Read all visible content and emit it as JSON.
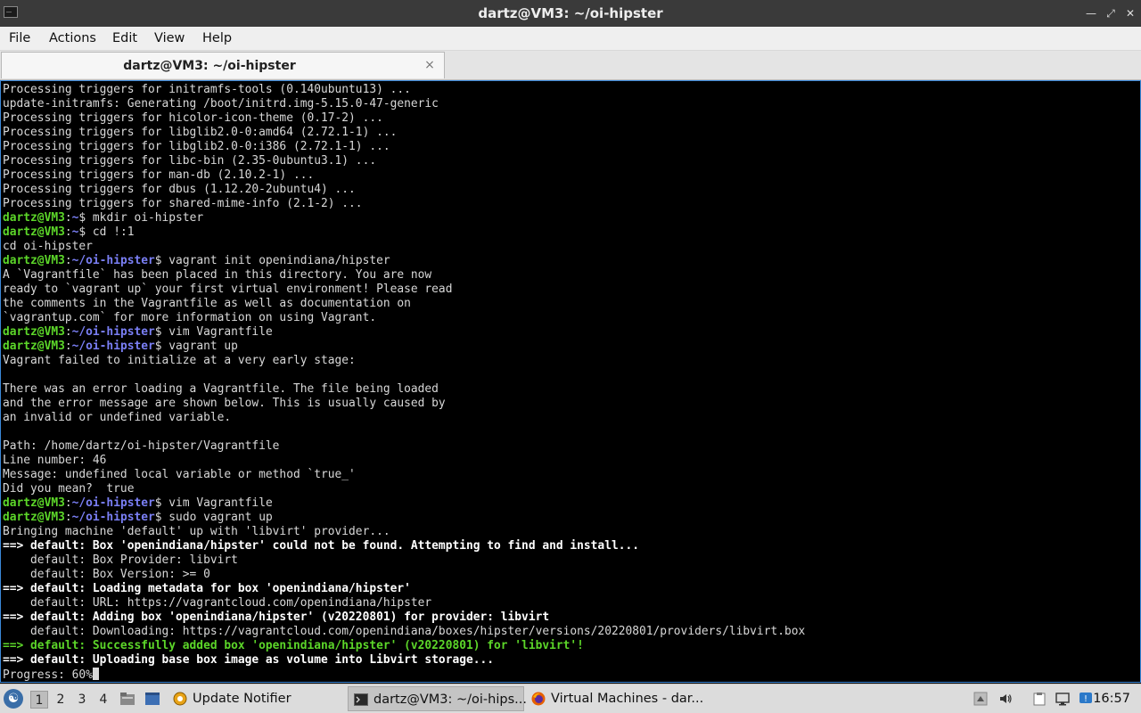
{
  "window": {
    "title": "dartz@VM3: ~/oi-hipster",
    "minimize_icon": "minimize-icon",
    "maximize_icon": "maximize-icon",
    "close_icon": "close-icon"
  },
  "menubar": {
    "items": [
      "File",
      "Actions",
      "Edit",
      "View",
      "Help"
    ]
  },
  "tab": {
    "label": "dartz@VM3: ~/oi-hipster",
    "close_glyph": "×"
  },
  "terminal": {
    "colors": {
      "user": "#5cd629",
      "path": "#7a7ff5",
      "text": "#d8d8d8"
    },
    "lines": [
      {
        "t": "plain",
        "text": "Processing triggers for initramfs-tools (0.140ubuntu13) ..."
      },
      {
        "t": "plain",
        "text": "update-initramfs: Generating /boot/initrd.img-5.15.0-47-generic"
      },
      {
        "t": "plain",
        "text": "Processing triggers for hicolor-icon-theme (0.17-2) ..."
      },
      {
        "t": "plain",
        "text": "Processing triggers for libglib2.0-0:amd64 (2.72.1-1) ..."
      },
      {
        "t": "plain",
        "text": "Processing triggers for libglib2.0-0:i386 (2.72.1-1) ..."
      },
      {
        "t": "plain",
        "text": "Processing triggers for libc-bin (2.35-0ubuntu3.1) ..."
      },
      {
        "t": "plain",
        "text": "Processing triggers for man-db (2.10.2-1) ..."
      },
      {
        "t": "plain",
        "text": "Processing triggers for dbus (1.12.20-2ubuntu4) ..."
      },
      {
        "t": "plain",
        "text": "Processing triggers for shared-mime-info (2.1-2) ..."
      },
      {
        "t": "prompt",
        "user": "dartz@VM3",
        "path": "~",
        "cmd": "mkdir oi-hipster"
      },
      {
        "t": "prompt",
        "user": "dartz@VM3",
        "path": "~",
        "cmd": "cd !:1"
      },
      {
        "t": "plain",
        "text": "cd oi-hipster"
      },
      {
        "t": "prompt",
        "user": "dartz@VM3",
        "path": "~/oi-hipster",
        "cmd": "vagrant init openindiana/hipster"
      },
      {
        "t": "plain",
        "text": "A `Vagrantfile` has been placed in this directory. You are now"
      },
      {
        "t": "plain",
        "text": "ready to `vagrant up` your first virtual environment! Please read"
      },
      {
        "t": "plain",
        "text": "the comments in the Vagrantfile as well as documentation on"
      },
      {
        "t": "plain",
        "text": "`vagrantup.com` for more information on using Vagrant."
      },
      {
        "t": "prompt",
        "user": "dartz@VM3",
        "path": "~/oi-hipster",
        "cmd": "vim Vagrantfile"
      },
      {
        "t": "prompt",
        "user": "dartz@VM3",
        "path": "~/oi-hipster",
        "cmd": "vagrant up"
      },
      {
        "t": "plain",
        "text": "Vagrant failed to initialize at a very early stage:"
      },
      {
        "t": "plain",
        "text": ""
      },
      {
        "t": "plain",
        "text": "There was an error loading a Vagrantfile. The file being loaded"
      },
      {
        "t": "plain",
        "text": "and the error message are shown below. This is usually caused by"
      },
      {
        "t": "plain",
        "text": "an invalid or undefined variable."
      },
      {
        "t": "plain",
        "text": ""
      },
      {
        "t": "plain",
        "text": "Path: /home/dartz/oi-hipster/Vagrantfile"
      },
      {
        "t": "plain",
        "text": "Line number: 46"
      },
      {
        "t": "plain",
        "text": "Message: undefined local variable or method `true_'"
      },
      {
        "t": "plain",
        "text": "Did you mean?  true"
      },
      {
        "t": "prompt",
        "user": "dartz@VM3",
        "path": "~/oi-hipster",
        "cmd": "vim Vagrantfile"
      },
      {
        "t": "prompt",
        "user": "dartz@VM3",
        "path": "~/oi-hipster",
        "cmd": "sudo vagrant up"
      },
      {
        "t": "plain",
        "text": "Bringing machine 'default' up with 'libvirt' provider..."
      },
      {
        "t": "bold",
        "text": "==> default: Box 'openindiana/hipster' could not be found. Attempting to find and install..."
      },
      {
        "t": "plain",
        "text": "    default: Box Provider: libvirt"
      },
      {
        "t": "plain",
        "text": "    default: Box Version: >= 0"
      },
      {
        "t": "bold",
        "text": "==> default: Loading metadata for box 'openindiana/hipster'"
      },
      {
        "t": "plain",
        "text": "    default: URL: https://vagrantcloud.com/openindiana/hipster"
      },
      {
        "t": "bold",
        "text": "==> default: Adding box 'openindiana/hipster' (v20220801) for provider: libvirt"
      },
      {
        "t": "plain",
        "text": "    default: Downloading: https://vagrantcloud.com/openindiana/boxes/hipster/versions/20220801/providers/libvirt.box"
      },
      {
        "t": "green",
        "text": "==> default: Successfully added box 'openindiana/hipster' (v20220801) for 'libvirt'!"
      },
      {
        "t": "bold",
        "text": "==> default: Uploading base box image as volume into Libvirt storage..."
      },
      {
        "t": "cursor",
        "text": "Progress: 60%"
      }
    ]
  },
  "taskbar": {
    "start_icon": "start-menu-icon",
    "workspaces": [
      "1",
      "2",
      "3",
      "4"
    ],
    "active_workspace": "1",
    "tasks": [
      {
        "label": "Update Notifier",
        "icon": "update-notifier-icon"
      },
      {
        "label": "dartz@VM3: ~/oi-hips...",
        "icon": "terminal-icon"
      },
      {
        "label": "Virtual Machines - dar...",
        "icon": "firefox-icon"
      }
    ],
    "clock": "16:57"
  }
}
